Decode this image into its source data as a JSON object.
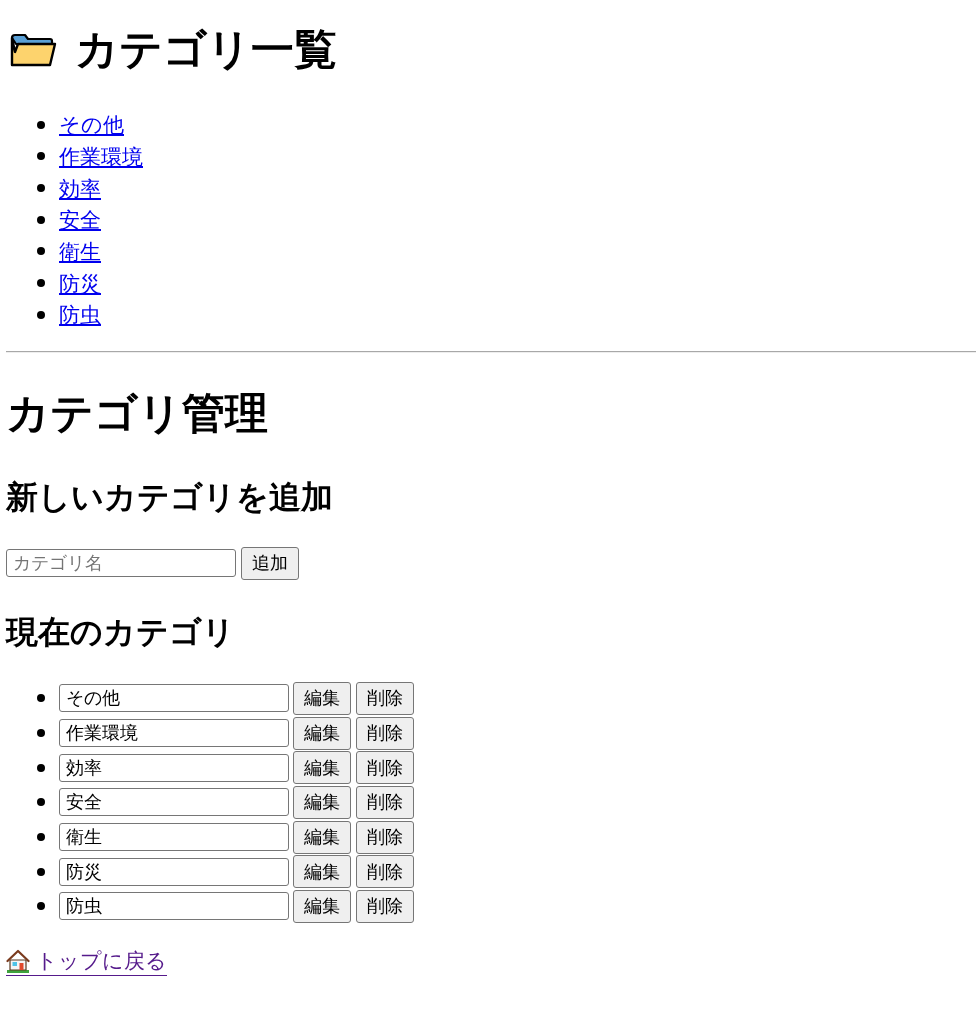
{
  "heading": {
    "title": "カテゴリ一覧"
  },
  "category_links": [
    {
      "label": "その他",
      "visited": false
    },
    {
      "label": "作業環境",
      "visited": false
    },
    {
      "label": "効率",
      "visited": false
    },
    {
      "label": "安全",
      "visited": false
    },
    {
      "label": "衛生",
      "visited": false
    },
    {
      "label": "防災",
      "visited": false
    },
    {
      "label": "防虫",
      "visited": false
    }
  ],
  "management": {
    "title": "カテゴリ管理",
    "add_section": {
      "title": "新しいカテゴリを追加",
      "input": {
        "placeholder": "カテゴリ名"
      },
      "button": "追加"
    },
    "current_section": {
      "title": "現在のカテゴリ",
      "items": [
        {
          "value": "その他",
          "edit_button": "編集",
          "delete_button": "削除"
        },
        {
          "value": "作業環境",
          "edit_button": "編集",
          "delete_button": "削除"
        },
        {
          "value": "効率",
          "edit_button": "編集",
          "delete_button": "削除"
        },
        {
          "value": "安全",
          "edit_button": "編集",
          "delete_button": "削除"
        },
        {
          "value": "衛生",
          "edit_button": "編集",
          "delete_button": "削除"
        },
        {
          "value": "防災",
          "edit_button": "編集",
          "delete_button": "削除"
        },
        {
          "value": "防虫",
          "edit_button": "編集",
          "delete_button": "削除"
        }
      ]
    }
  },
  "back_link": {
    "label": "トップに戻る",
    "visited": true
  }
}
